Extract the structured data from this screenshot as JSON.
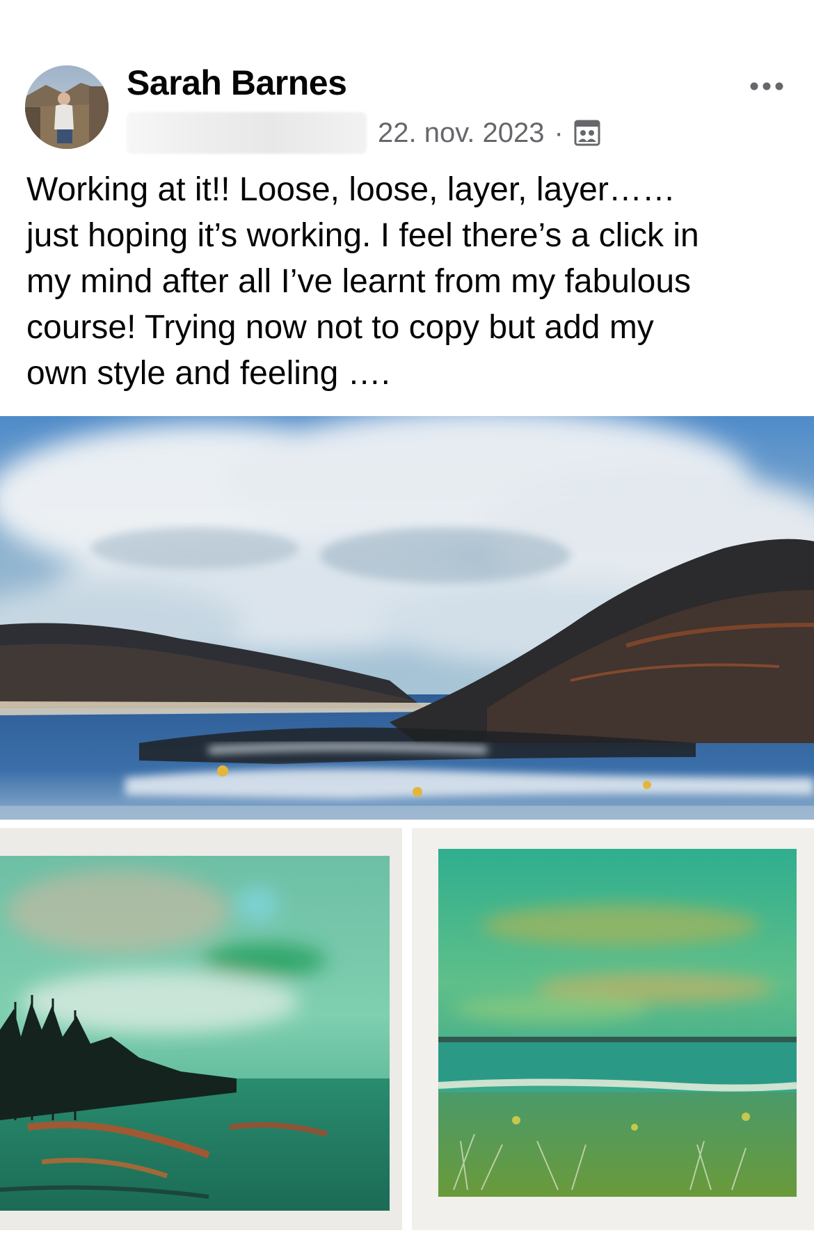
{
  "post": {
    "author": {
      "name": "Sarah Barnes"
    },
    "date": "22. nov. 2023",
    "separator": "·",
    "audience_icon": "group-audience-icon",
    "more_icon": "more-options-icon",
    "text": "Working at it!! Loose, loose, layer, layer……\njust hoping it’s working. I feel there’s a click in\nmy mind after all I’ve learnt from my fabulous\ncourse! Trying now not to copy but add my\nown style and feeling …."
  },
  "colors": {
    "text_primary": "#050505",
    "text_secondary": "#65676b",
    "background": "#ffffff"
  }
}
